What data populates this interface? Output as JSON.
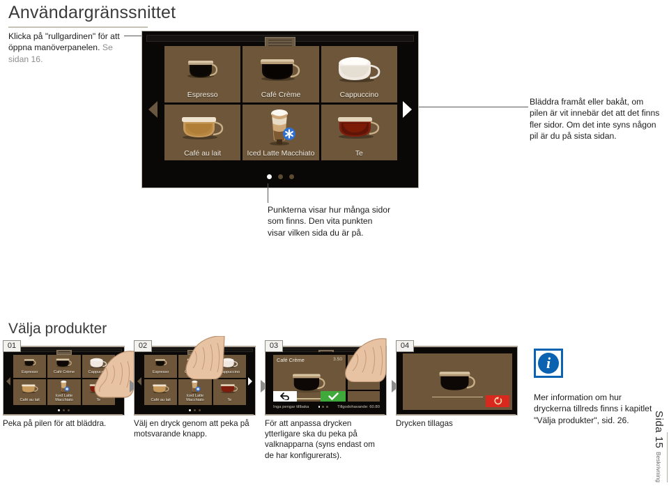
{
  "page": {
    "title": "Användargränssnittet",
    "section_title": "Välja produkter",
    "page_label": "Sida 15",
    "section_label": "Beskrivning"
  },
  "notes": {
    "blind": "Klicka på \"rullgardinen\" för att öppna manöverpanelen.",
    "blind_ref": "Se sidan 16.",
    "arrows": "Bläddra framåt eller bakåt, om pilen är vit innebär det att det finns fler sidor. Om det inte syns någon pil är du på sista sidan.",
    "dots": "Punkterna visar hur många sidor som finns. Den vita punkten visar vilken sida du är på.",
    "info": "Mer information om hur dryckerna tillreds finns i kapitlet \"Välja produkter\", sid. 26."
  },
  "display": {
    "products": [
      {
        "name": "Espresso",
        "icon": "espresso-cup-icon"
      },
      {
        "name": "Café Crème",
        "icon": "cafe-creme-cup-icon"
      },
      {
        "name": "Cappuccino",
        "icon": "cappuccino-cup-icon"
      },
      {
        "name": "Café au lait",
        "icon": "cafe-au-lait-cup-icon"
      },
      {
        "name": "Iced Latte Macchiato",
        "icon": "iced-latte-macchiato-glass-icon"
      },
      {
        "name": "Te",
        "icon": "tea-cup-icon"
      }
    ],
    "pages": {
      "count": 3,
      "active_index": 0
    },
    "arrow_left_state": "inactive",
    "arrow_right_state": "active",
    "tile_color": "#6d5639",
    "screen_color": "#090807"
  },
  "steps": [
    {
      "number": "01",
      "caption": "Peka på pilen för att bläddra.",
      "screen": "product-grid",
      "hand_target": "right-arrow"
    },
    {
      "number": "02",
      "caption": "Välj en dryck genom att peka på motsvarande knapp.",
      "screen": "product-grid",
      "hand_target": "cafe-creme-tile"
    },
    {
      "number": "03",
      "caption": "För att anpassa drycken ytterligare ska du peka på valknapparna (syns endast om de har konfigurerats).",
      "screen": "product-detail",
      "hand_target": "option-buttons",
      "detail": {
        "title": "Café Crème",
        "price": "3.50",
        "left_status": "Inga pengar tillbaka",
        "right_status": "Tillgodohavande: 60.80",
        "back_icon": "back-arrow-icon",
        "confirm_icon": "checkmark-icon",
        "confirm_color": "#3faa3b",
        "option_button_count": 4,
        "pages": {
          "count": 3,
          "active_index": 0
        }
      }
    },
    {
      "number": "04",
      "caption": "Drycken tillagas",
      "screen": "brewing",
      "brewing": {
        "stop_icon": "stop-brewing-icon",
        "stop_color": "#d9281e"
      }
    }
  ],
  "info_icon": {
    "name": "information-icon",
    "glyph": "i",
    "color": "#0b62b0"
  }
}
